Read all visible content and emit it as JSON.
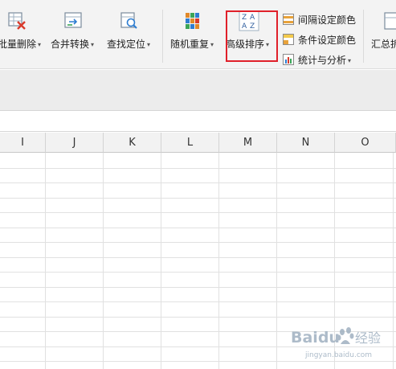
{
  "ribbon": {
    "batch_delete": "批量删除",
    "merge_convert": "合并转换",
    "find_locate": "查找定位",
    "random_repeat": "随机重复",
    "advanced_sort": "高级排序",
    "interval_color": "间隔设定颜色",
    "condition_color": "条件设定颜色",
    "stats_analysis": "统计与分析",
    "summary_cut": "汇总拆",
    "sort_icon_text": [
      "Z",
      "A",
      "A",
      "Z"
    ]
  },
  "columns": [
    "I",
    "J",
    "K",
    "L",
    "M",
    "N",
    "O"
  ],
  "watermark": {
    "logo": "Baidu",
    "sub": "jingyan.baidu.com"
  },
  "colors": {
    "highlight": "#e0202a",
    "ribbon_bg": "#f3f3f3",
    "header_bg": "#f2f2f2"
  }
}
